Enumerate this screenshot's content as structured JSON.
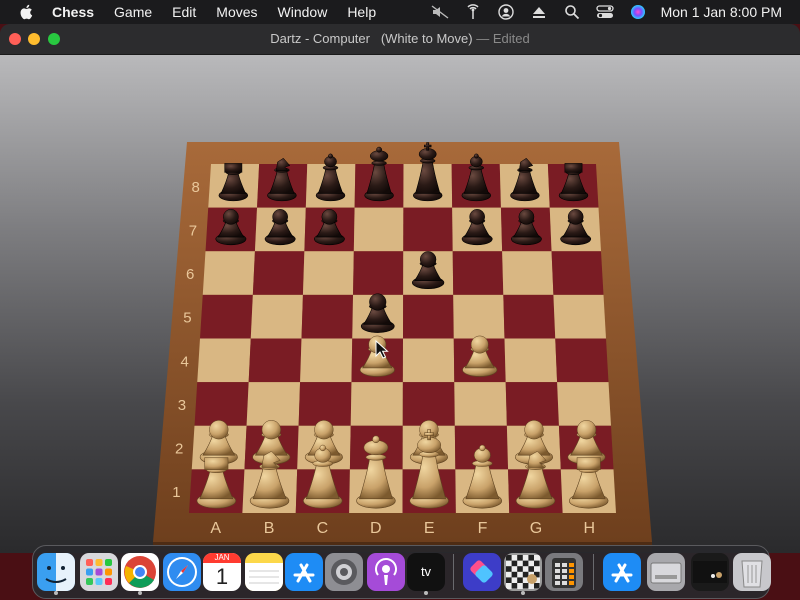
{
  "menubar": {
    "app_name": "Chess",
    "items": [
      "Game",
      "Edit",
      "Moves",
      "Window",
      "Help"
    ],
    "status_icons": [
      "mute-icon",
      "antenna-icon",
      "user-icon",
      "eject-icon",
      "search-icon",
      "control-center-icon",
      "siri-icon"
    ],
    "clock": "Mon 1 Jan  8:00 PM"
  },
  "window": {
    "title": "Dartz - Computer",
    "subtitle": "(White to Move)",
    "separator": "—",
    "edited": "Edited"
  },
  "board": {
    "files": [
      "A",
      "B",
      "C",
      "D",
      "E",
      "F",
      "G",
      "H"
    ],
    "ranks": [
      "8",
      "7",
      "6",
      "5",
      "4",
      "3",
      "2",
      "1"
    ],
    "light_square_color": "#d9b783",
    "dark_square_color": "#7a1c24",
    "frame_color": "#a86a3a",
    "white_piece_color": "#c9a26a",
    "black_piece_color": "#2a1a16",
    "pieces": [
      {
        "square": "a8",
        "side": "black",
        "type": "rook"
      },
      {
        "square": "b8",
        "side": "black",
        "type": "knight"
      },
      {
        "square": "c8",
        "side": "black",
        "type": "bishop"
      },
      {
        "square": "d8",
        "side": "black",
        "type": "queen"
      },
      {
        "square": "e8",
        "side": "black",
        "type": "king"
      },
      {
        "square": "f8",
        "side": "black",
        "type": "bishop"
      },
      {
        "square": "g8",
        "side": "black",
        "type": "knight"
      },
      {
        "square": "h8",
        "side": "black",
        "type": "rook"
      },
      {
        "square": "a7",
        "side": "black",
        "type": "pawn"
      },
      {
        "square": "b7",
        "side": "black",
        "type": "pawn"
      },
      {
        "square": "c7",
        "side": "black",
        "type": "pawn"
      },
      {
        "square": "f7",
        "side": "black",
        "type": "pawn"
      },
      {
        "square": "g7",
        "side": "black",
        "type": "pawn"
      },
      {
        "square": "h7",
        "side": "black",
        "type": "pawn"
      },
      {
        "square": "e6",
        "side": "black",
        "type": "pawn"
      },
      {
        "square": "d5",
        "side": "black",
        "type": "pawn"
      },
      {
        "square": "d4",
        "side": "white",
        "type": "pawn"
      },
      {
        "square": "f4",
        "side": "white",
        "type": "pawn"
      },
      {
        "square": "a2",
        "side": "white",
        "type": "pawn"
      },
      {
        "square": "b2",
        "side": "white",
        "type": "pawn"
      },
      {
        "square": "c2",
        "side": "white",
        "type": "pawn"
      },
      {
        "square": "e2",
        "side": "white",
        "type": "pawn"
      },
      {
        "square": "g2",
        "side": "white",
        "type": "pawn"
      },
      {
        "square": "h2",
        "side": "white",
        "type": "pawn"
      },
      {
        "square": "a1",
        "side": "white",
        "type": "rook"
      },
      {
        "square": "b1",
        "side": "white",
        "type": "knight"
      },
      {
        "square": "c1",
        "side": "white",
        "type": "bishop"
      },
      {
        "square": "d1",
        "side": "white",
        "type": "queen"
      },
      {
        "square": "e1",
        "side": "white",
        "type": "king"
      },
      {
        "square": "f1",
        "side": "white",
        "type": "bishop"
      },
      {
        "square": "g1",
        "side": "white",
        "type": "knight"
      },
      {
        "square": "h1",
        "side": "white",
        "type": "rook"
      }
    ]
  },
  "dock": {
    "apps": [
      {
        "name": "finder-icon",
        "color": "#3a9ff0",
        "running": true
      },
      {
        "name": "launchpad-icon",
        "color": "#d8d8dc",
        "running": false
      },
      {
        "name": "chrome-icon",
        "color": "#ffffff",
        "running": true
      },
      {
        "name": "safari-icon",
        "color": "#2f8cf0",
        "running": false
      },
      {
        "name": "calendar-icon",
        "color": "#ffffff",
        "running": false,
        "month": "JAN",
        "day": "1"
      },
      {
        "name": "notes-icon",
        "color": "#fcd84a",
        "running": false
      },
      {
        "name": "app-store-icon",
        "color": "#1e8cf5",
        "running": false
      },
      {
        "name": "system-settings-icon",
        "color": "#8e8e93",
        "running": false
      },
      {
        "name": "podcasts-icon",
        "color": "#a54bd8",
        "running": false
      },
      {
        "name": "apple-tv-icon",
        "color": "#111111",
        "running": true,
        "label": "tv"
      },
      {
        "name": "shortcuts-icon",
        "color": "#3d3dc8",
        "running": false
      },
      {
        "name": "chess-icon",
        "color": "#9a9a9a",
        "running": true
      },
      {
        "name": "calculator-icon",
        "color": "#7a7a7e",
        "running": false
      },
      {
        "name": "app-store-downloads-icon",
        "color": "#1e8cf5",
        "running": false
      },
      {
        "name": "disk-icon",
        "color": "#a8a8ac",
        "running": false
      },
      {
        "name": "minimized-window-icon",
        "color": "#1a1a1a",
        "running": false
      },
      {
        "name": "trash-icon",
        "color": "#c8c8cc",
        "running": false
      }
    ]
  }
}
